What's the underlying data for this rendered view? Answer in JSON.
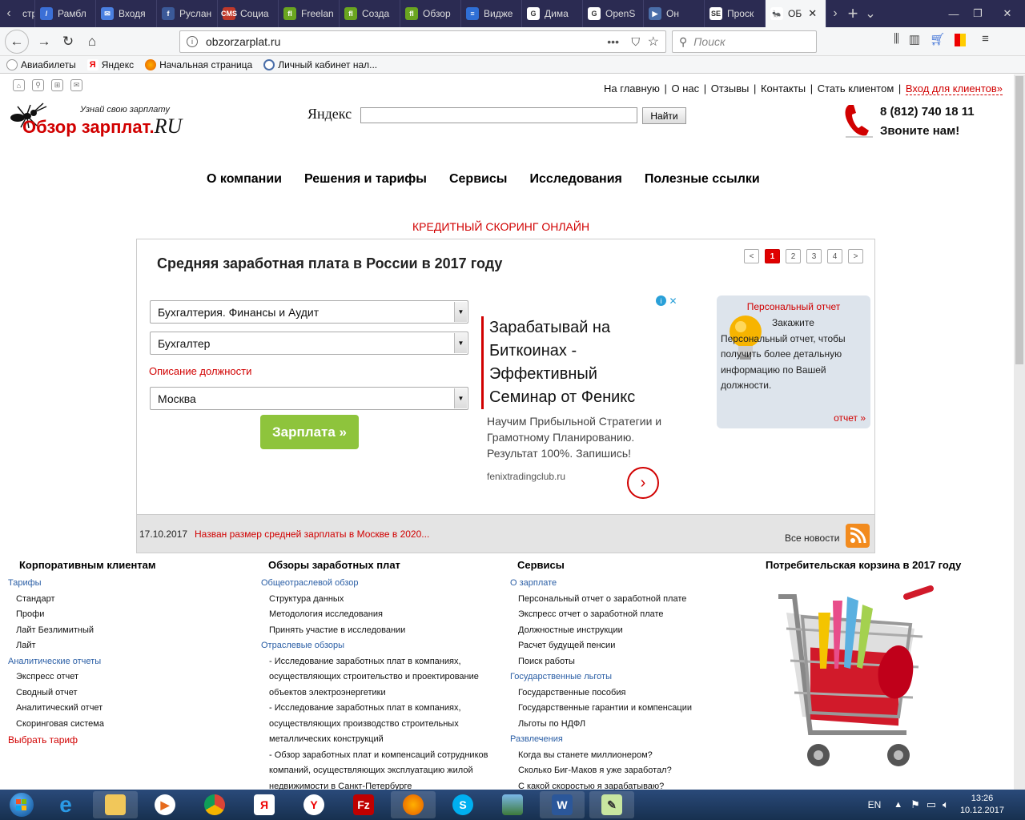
{
  "browser": {
    "tabs": [
      {
        "label": "стр",
        "color": "#555",
        "glyph": ""
      },
      {
        "label": "Рамбл",
        "color": "#3b6fd6",
        "glyph": "/"
      },
      {
        "label": "Входя",
        "color": "#4a7fe0",
        "glyph": "✉"
      },
      {
        "label": "Руслан",
        "color": "#3b5998",
        "glyph": "f"
      },
      {
        "label": "Социа",
        "color": "#c0392b",
        "glyph": "CMS"
      },
      {
        "label": "Freelan",
        "color": "#6aa520",
        "glyph": "fl"
      },
      {
        "label": "Созда",
        "color": "#6aa520",
        "glyph": "fl"
      },
      {
        "label": "Обзор",
        "color": "#6aa520",
        "glyph": "fl"
      },
      {
        "label": "Видже",
        "color": "#2f6fd6",
        "glyph": "≡"
      },
      {
        "label": "Дима",
        "color": "#ffffff",
        "glyph": "G"
      },
      {
        "label": "OpenS",
        "color": "#ffffff",
        "glyph": "G"
      },
      {
        "label": "Он",
        "color": "#4a6ea9",
        "glyph": "▶"
      },
      {
        "label": "Проск",
        "color": "#ffffff",
        "glyph": "SE"
      },
      {
        "label": "ОБ",
        "color": "#ffffff",
        "glyph": "🐜"
      }
    ],
    "url": "obzorzarplat.ru",
    "search_placeholder": "Поиск",
    "bookmarks": [
      "Авиабилеты",
      "Яндекс",
      "Начальная страница",
      "Личный кабинет нал..."
    ]
  },
  "site": {
    "logo_tagline": "Узнай свою зарплату",
    "logo_main": "Обзор зарплат.",
    "logo_ru": "RU",
    "yandex_label": "Яндекс",
    "search_button": "Найти",
    "phone": "8 (812) 740 18 11",
    "phone_note": "Звоните нам!",
    "top_links": [
      "На главную",
      "О нас",
      "Отзывы",
      "Контакты",
      "Стать клиентом"
    ],
    "client_login": "Вход для клиентов»",
    "menu": [
      "О компании",
      "Решения и тарифы",
      "Сервисы",
      "Исследования",
      "Полезные ссылки"
    ],
    "promo": "КРЕДИТНЫЙ СКОРИНГ ОНЛАЙН"
  },
  "panel": {
    "title": "Средняя заработная плата в России в 2017 году",
    "pages": [
      "<",
      "1",
      "2",
      "3",
      "4",
      ">"
    ],
    "industry": "Бухгалтерия. Финансы и Аудит",
    "position": "Бухгалтер",
    "description_link": "Описание должности",
    "city": "Москва",
    "salary_button": "Зарплата »",
    "ad": {
      "headline": "Зарабатывай на Биткоинах - Эффективный Семинар от Феникс",
      "text": "Научим Прибыльной Стратегии и Грамотному Планированию. Результат 100%. Запишись!",
      "domain": "fenixtradingclub.ru"
    },
    "report": {
      "title": "Персональный отчет",
      "text": "Закажите Персональный отчет, чтобы получить более детальную информацию по Вашей должности.",
      "link": "отчет »"
    },
    "news_date": "17.10.2017",
    "news_text": "Назван размер средней зарплаты в Москве в 2020...",
    "all_news": "Все новости"
  },
  "footer": {
    "corporate": {
      "title": "Корпоративным клиентам",
      "items": [
        {
          "t": "h",
          "v": "Тарифы"
        },
        {
          "t": "i",
          "v": "Стандарт"
        },
        {
          "t": "i",
          "v": "Профи"
        },
        {
          "t": "i",
          "v": "Лайт Безлимитный"
        },
        {
          "t": "i",
          "v": "Лайт"
        },
        {
          "t": "h",
          "v": "Аналитические отчеты"
        },
        {
          "t": "i",
          "v": "Экспресс отчет"
        },
        {
          "t": "i",
          "v": "Сводный отчет"
        },
        {
          "t": "i",
          "v": "Аналитический отчет"
        },
        {
          "t": "i",
          "v": "Скоринговая система"
        },
        {
          "t": "r",
          "v": "Выбрать тариф"
        }
      ]
    },
    "reviews": {
      "title": "Обзоры заработных плат",
      "items": [
        {
          "t": "h",
          "v": "Общеотраслевой обзор"
        },
        {
          "t": "i",
          "v": "Структура данных"
        },
        {
          "t": "i",
          "v": "Методология исследования"
        },
        {
          "t": "i",
          "v": "Принять участие в исследовании"
        },
        {
          "t": "h",
          "v": "Отраслевые обзоры"
        },
        {
          "t": "i",
          "v": "- Исследование заработных плат в компаниях,"
        },
        {
          "t": "i",
          "v": "осуществляющих строительство и проектирование"
        },
        {
          "t": "i",
          "v": "объектов электроэнергетики"
        },
        {
          "t": "i",
          "v": "- Исследование заработных плат в компаниях,"
        },
        {
          "t": "i",
          "v": "осуществляющих производство строительных"
        },
        {
          "t": "i",
          "v": "металлических конструкций"
        },
        {
          "t": "i",
          "v": "- Обзор заработных плат и компенсаций сотрудников"
        },
        {
          "t": "i",
          "v": "компаний, осуществляющих эксплуатацию жилой"
        },
        {
          "t": "i",
          "v": "недвижимости в Санкт-Петербурге"
        }
      ]
    },
    "services": {
      "title": "Сервисы",
      "items": [
        {
          "t": "h",
          "v": "О зарплате"
        },
        {
          "t": "i",
          "v": "Персональный отчет о заработной плате"
        },
        {
          "t": "i",
          "v": "Экспресс отчет о заработной плате"
        },
        {
          "t": "i",
          "v": "Должностные инструкции"
        },
        {
          "t": "i",
          "v": "Расчет будущей пенсии"
        },
        {
          "t": "i",
          "v": "Поиск работы"
        },
        {
          "t": "h",
          "v": "Государственные льготы"
        },
        {
          "t": "i",
          "v": "Государственные пособия"
        },
        {
          "t": "i",
          "v": "Государственные гарантии и компенсации"
        },
        {
          "t": "i",
          "v": "Льготы по НДФЛ"
        },
        {
          "t": "h",
          "v": "Развлечения"
        },
        {
          "t": "i",
          "v": "Когда вы станете миллионером?"
        },
        {
          "t": "i",
          "v": "Сколько Биг-Маков я уже заработал?"
        },
        {
          "t": "i",
          "v": "С какой скоростью я зарабатываю?"
        }
      ]
    },
    "basket_title": "Потребительская корзина в 2017 году"
  },
  "taskbar": {
    "lang": "EN",
    "time": "13:26",
    "date": "10.12.2017"
  }
}
